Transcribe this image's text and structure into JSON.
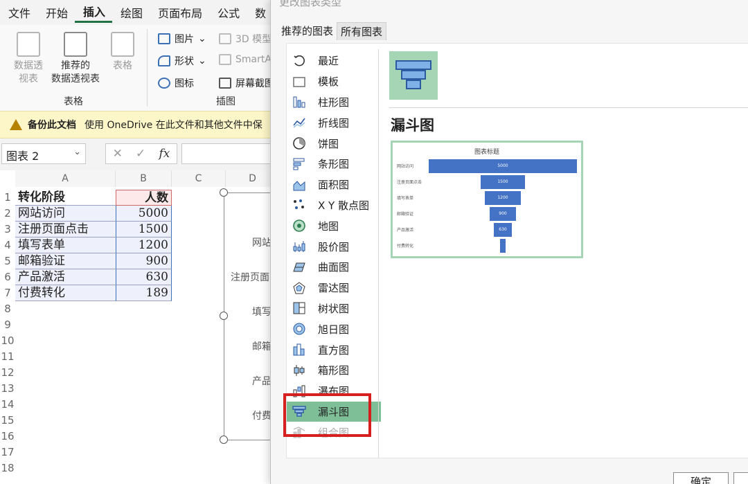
{
  "menu": [
    "文件",
    "开始",
    "插入",
    "绘图",
    "页面布局",
    "公式",
    "数"
  ],
  "ribbon": {
    "pivot": "数据透\n视表",
    "recommended_pivot": "推荐的\n数据透视表",
    "table": "表格",
    "group_tables": "表格",
    "pictures": "图片",
    "shapes": "形状",
    "icons": "图标",
    "model3d": "3D 模型",
    "smartart": "SmartA",
    "screenshot": "屏幕截图",
    "group_illustrations": "插图"
  },
  "banner": {
    "title": "备份此文档",
    "text": "使用 OneDrive 在此文件和其他文件中保"
  },
  "formula_bar": {
    "name_box": "图表 2",
    "fx": "fx"
  },
  "sheet": {
    "columns": [
      "A",
      "B",
      "C",
      "D"
    ],
    "rows": [
      "1",
      "2",
      "3",
      "4",
      "5",
      "6",
      "7",
      "8",
      "9",
      "10",
      "11",
      "12",
      "13",
      "14",
      "15",
      "16",
      "17",
      "18"
    ],
    "header_stage": "转化阶段",
    "header_count": "人数",
    "data": [
      {
        "stage": "网站访问",
        "count": "5000"
      },
      {
        "stage": "注册页面点击",
        "count": "1500"
      },
      {
        "stage": "填写表单",
        "count": "1200"
      },
      {
        "stage": "邮箱验证",
        "count": "900"
      },
      {
        "stage": "产品激活",
        "count": "630"
      },
      {
        "stage": "付费转化",
        "count": "189"
      }
    ],
    "chart_labels": [
      "网站",
      "注册页面",
      "填写",
      "邮箱",
      "产品",
      "付费"
    ]
  },
  "dialog": {
    "title": "更改图表类型",
    "tabs": [
      "推荐的图表",
      "所有图表"
    ],
    "chart_types": [
      {
        "label": "最近",
        "icon": "recent-icon"
      },
      {
        "label": "模板",
        "icon": "folder-icon"
      },
      {
        "label": "柱形图",
        "icon": "column-chart-icon"
      },
      {
        "label": "折线图",
        "icon": "line-chart-icon"
      },
      {
        "label": "饼图",
        "icon": "pie-chart-icon"
      },
      {
        "label": "条形图",
        "icon": "bar-chart-icon"
      },
      {
        "label": "面积图",
        "icon": "area-chart-icon"
      },
      {
        "label": "X Y 散点图",
        "icon": "scatter-chart-icon"
      },
      {
        "label": "地图",
        "icon": "map-chart-icon"
      },
      {
        "label": "股价图",
        "icon": "stock-chart-icon"
      },
      {
        "label": "曲面图",
        "icon": "surface-chart-icon"
      },
      {
        "label": "雷达图",
        "icon": "radar-chart-icon"
      },
      {
        "label": "树状图",
        "icon": "treemap-chart-icon"
      },
      {
        "label": "旭日图",
        "icon": "sunburst-chart-icon"
      },
      {
        "label": "直方图",
        "icon": "histogram-chart-icon"
      },
      {
        "label": "箱形图",
        "icon": "box-chart-icon"
      },
      {
        "label": "瀑布图",
        "icon": "waterfall-chart-icon"
      },
      {
        "label": "漏斗图",
        "icon": "funnel-chart-icon"
      },
      {
        "label": "组合图",
        "icon": "combo-chart-icon"
      }
    ],
    "selected_type": "漏斗图",
    "preview_title": "漏斗图",
    "ok": "确定"
  },
  "chart_data": {
    "type": "bar",
    "title": "图表标题",
    "categories": [
      "网站访问",
      "注册页面点击",
      "填写表单",
      "邮箱验证",
      "产品激活",
      "付费转化"
    ],
    "values": [
      5000,
      1500,
      1200,
      900,
      630,
      189
    ]
  },
  "colors": {
    "selection_green": "#7fbf98",
    "thumb_green": "#a5d5b5",
    "highlight_red": "#d61f1f",
    "bar_blue": "#4472c4",
    "excel_green": "#217346"
  }
}
